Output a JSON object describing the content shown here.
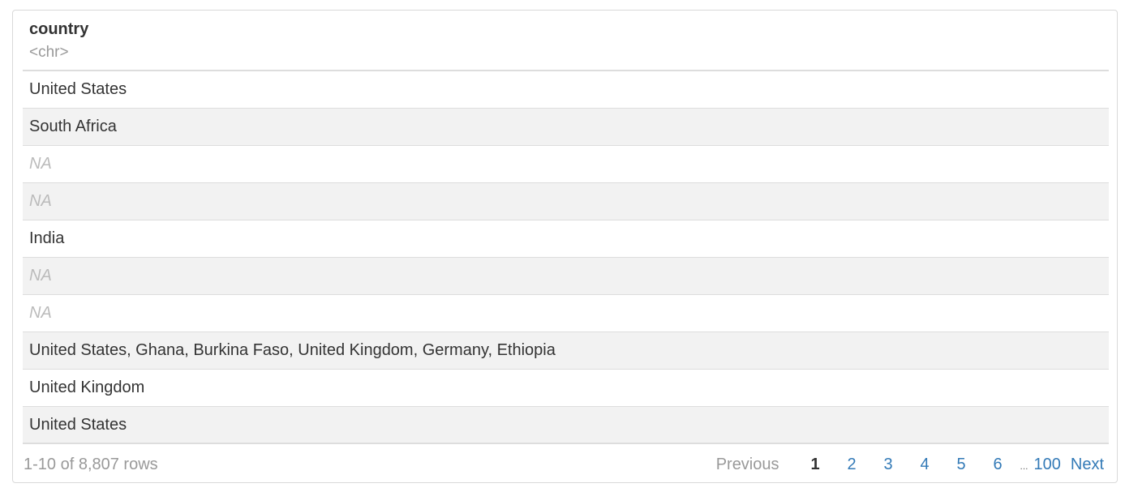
{
  "table": {
    "column": {
      "name": "country",
      "type": "<chr>"
    },
    "rows": [
      {
        "value": "United States",
        "is_na": false
      },
      {
        "value": "South Africa",
        "is_na": false
      },
      {
        "value": "NA",
        "is_na": true
      },
      {
        "value": "NA",
        "is_na": true
      },
      {
        "value": "India",
        "is_na": false
      },
      {
        "value": "NA",
        "is_na": true
      },
      {
        "value": "NA",
        "is_na": true
      },
      {
        "value": "United States, Ghana, Burkina Faso, United Kingdom, Germany, Ethiopia",
        "is_na": false
      },
      {
        "value": "United Kingdom",
        "is_na": false
      },
      {
        "value": "United States",
        "is_na": false
      }
    ]
  },
  "footer": {
    "row_count": "1-10 of 8,807 rows",
    "pagination": {
      "previous_label": "Previous",
      "pages": [
        "1",
        "2",
        "3",
        "4",
        "5",
        "6"
      ],
      "current_page": "1",
      "ellipsis": "...",
      "last_page": "100",
      "next_label": "Next"
    }
  },
  "colors": {
    "link": "#337ab7",
    "muted": "#999999",
    "na_text": "#bbbbbb",
    "stripe": "#f2f2f2",
    "border": "#dddddd"
  }
}
